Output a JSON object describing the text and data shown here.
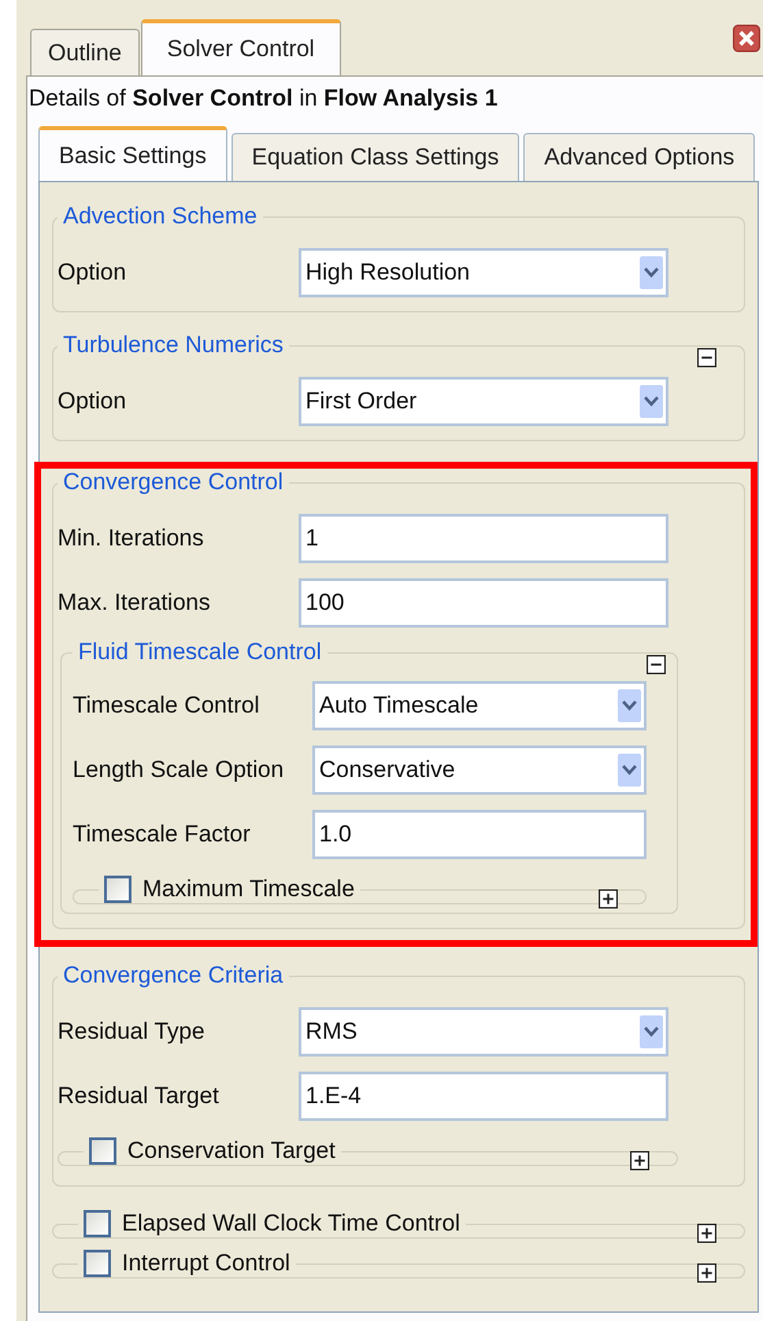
{
  "panel_tabs": [
    {
      "label": "Outline",
      "selected": false
    },
    {
      "label": "Solver Control",
      "selected": true
    }
  ],
  "details_title": "Details of **Solver Control** in **Flow Analysis 1**",
  "tabs": [
    {
      "label": "Basic Settings",
      "selected": true
    },
    {
      "label": "Equation Class Settings",
      "selected": false
    },
    {
      "label": "Advanced Options",
      "selected": false
    }
  ],
  "items": [
    {
      "kind": "section",
      "title": "Advection Scheme",
      "highlighted": false,
      "rows": [
        {
          "kind": "dropdown",
          "label": "Option",
          "value": "High Resolution"
        }
      ]
    },
    {
      "kind": "section",
      "title": "Turbulence Numerics",
      "expanded": true,
      "highlighted": false,
      "rows": [
        {
          "kind": "dropdown",
          "label": "Option",
          "value": "First Order"
        }
      ]
    },
    {
      "kind": "section",
      "title": "Convergence Control",
      "highlighted": true,
      "rows": [
        {
          "kind": "text",
          "label": "Min. Iterations",
          "value": "1"
        },
        {
          "kind": "text",
          "label": "Max. Iterations",
          "value": "100"
        },
        {
          "kind": "group",
          "title": "Fluid Timescale Control",
          "expanded": true,
          "rows": [
            {
              "kind": "dropdown",
              "label": "Timescale Control",
              "value": "Auto Timescale"
            },
            {
              "kind": "dropdown",
              "label": "Length Scale Option",
              "value": "Conservative"
            },
            {
              "kind": "text",
              "label": "Timescale Factor",
              "value": "1.0"
            },
            {
              "kind": "option",
              "label": "Maximum Timescale",
              "checked": false,
              "expanded": false
            }
          ]
        }
      ]
    },
    {
      "kind": "section",
      "title": "Convergence Criteria",
      "highlighted": false,
      "rows": [
        {
          "kind": "dropdown",
          "label": "Residual Type",
          "value": "RMS"
        },
        {
          "kind": "text",
          "label": "Residual Target",
          "value": "1.E-4"
        },
        {
          "kind": "option",
          "label": "Conservation Target",
          "checked": false,
          "expanded": false
        }
      ]
    },
    {
      "kind": "option",
      "label": "Elapsed Wall Clock Time Control",
      "checked": false,
      "expanded": false
    },
    {
      "kind": "option",
      "label": "Interrupt Control",
      "checked": false,
      "expanded": false
    }
  ]
}
